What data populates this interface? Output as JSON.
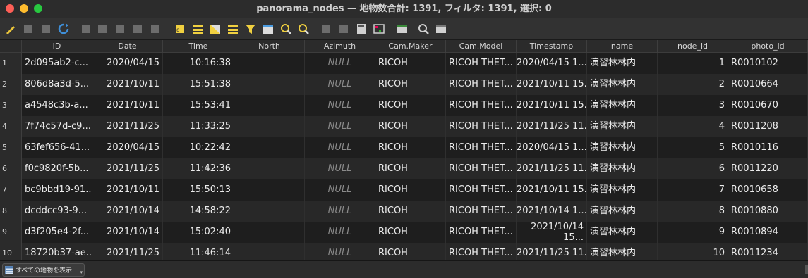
{
  "window": {
    "title": "panorama_nodes — 地物数合計: 1391, フィルタ: 1391, 選択: 0"
  },
  "toolbar": {
    "buttons": [
      {
        "name": "toggle-editing-pencil-icon",
        "color": "#e9c43a"
      },
      {
        "name": "multi-edit-icon",
        "color": "#7a7a7a"
      },
      {
        "name": "save-edits-icon",
        "color": "#7a7a7a"
      },
      {
        "name": "reload-table-icon",
        "color": "#3f8fd8"
      },
      {
        "name": "add-feature-icon",
        "color": "#7a7a7a"
      },
      {
        "name": "delete-feature-icon",
        "color": "#7a7a7a"
      },
      {
        "name": "cut-icon",
        "color": "#7a7a7a"
      },
      {
        "name": "copy-icon",
        "color": "#7a7a7a"
      },
      {
        "name": "paste-icon",
        "color": "#7a7a7a"
      },
      {
        "name": "select-by-expression-icon",
        "color": "#f0d040"
      },
      {
        "name": "select-all-icon",
        "color": "#f0d040"
      },
      {
        "name": "invert-selection-icon",
        "color": "#f0d040"
      },
      {
        "name": "deselect-all-icon",
        "color": "#f0d040"
      },
      {
        "name": "filter-select-icon",
        "color": "#f0d040"
      },
      {
        "name": "move-selection-top-icon",
        "color": "#4a9be0"
      },
      {
        "name": "pan-to-selected-icon",
        "color": "#f0d040"
      },
      {
        "name": "zoom-to-selected-icon",
        "color": "#f0d040"
      },
      {
        "name": "new-field-icon",
        "color": "#7a7a7a"
      },
      {
        "name": "delete-field-icon",
        "color": "#7a7a7a"
      },
      {
        "name": "field-calculator-icon",
        "color": "#d0d0d0"
      },
      {
        "name": "conditional-formatting-icon",
        "color": "#d0d0d0"
      },
      {
        "name": "dock-table-icon",
        "color": "#d0d0d0"
      },
      {
        "name": "actions-icon",
        "color": "#d0d0d0"
      },
      {
        "name": "table-view-icon",
        "color": "#d0d0d0"
      }
    ]
  },
  "table": {
    "columns": [
      "ID",
      "Date",
      "Time",
      "North",
      "Azimuth",
      "Cam.Maker",
      "Cam.Model",
      "Timestamp",
      "name",
      "node_id",
      "photo_id"
    ],
    "null_text": "NULL",
    "rows": [
      {
        "num": "1",
        "id": "2d095ab2-c...",
        "date": "2020/04/15",
        "time": "10:16:38",
        "north": "",
        "azimuth": "NULL",
        "maker": "RICOH",
        "model": "RICOH THET...",
        "timestamp": "2020/04/15 1...",
        "name": "演習林林内",
        "node_id": "1",
        "photo_id": "R0010102"
      },
      {
        "num": "2",
        "id": "806d8a3d-5...",
        "date": "2021/10/11",
        "time": "15:51:38",
        "north": "",
        "azimuth": "NULL",
        "maker": "RICOH",
        "model": "RICOH THET...",
        "timestamp": "2021/10/11 15...",
        "name": "演習林林内",
        "node_id": "2",
        "photo_id": "R0010664"
      },
      {
        "num": "3",
        "id": "a4548c3b-a...",
        "date": "2021/10/11",
        "time": "15:53:41",
        "north": "",
        "azimuth": "NULL",
        "maker": "RICOH",
        "model": "RICOH THET...",
        "timestamp": "2021/10/11 15...",
        "name": "演習林林内",
        "node_id": "3",
        "photo_id": "R0010670"
      },
      {
        "num": "4",
        "id": "7f74c57d-c9...",
        "date": "2021/11/25",
        "time": "11:33:25",
        "north": "",
        "azimuth": "NULL",
        "maker": "RICOH",
        "model": "RICOH THET...",
        "timestamp": "2021/11/25 11...",
        "name": "演習林林内",
        "node_id": "4",
        "photo_id": "R0011208"
      },
      {
        "num": "5",
        "id": "63fef656-41...",
        "date": "2020/04/15",
        "time": "10:22:42",
        "north": "",
        "azimuth": "NULL",
        "maker": "RICOH",
        "model": "RICOH THET...",
        "timestamp": "2020/04/15 1...",
        "name": "演習林林内",
        "node_id": "5",
        "photo_id": "R0010116"
      },
      {
        "num": "6",
        "id": "f0c9820f-5b...",
        "date": "2021/11/25",
        "time": "11:42:36",
        "north": "",
        "azimuth": "NULL",
        "maker": "RICOH",
        "model": "RICOH THET...",
        "timestamp": "2021/11/25 11...",
        "name": "演習林林内",
        "node_id": "6",
        "photo_id": "R0011220"
      },
      {
        "num": "7",
        "id": "bc9bbd19-91...",
        "date": "2021/10/11",
        "time": "15:50:13",
        "north": "",
        "azimuth": "NULL",
        "maker": "RICOH",
        "model": "RICOH THET...",
        "timestamp": "2021/10/11 15...",
        "name": "演習林林内",
        "node_id": "7",
        "photo_id": "R0010658"
      },
      {
        "num": "8",
        "id": "dcddcc93-9...",
        "date": "2021/10/14",
        "time": "14:58:22",
        "north": "",
        "azimuth": "NULL",
        "maker": "RICOH",
        "model": "RICOH THET...",
        "timestamp": "2021/10/14 1...",
        "name": "演習林林内",
        "node_id": "8",
        "photo_id": "R0010880"
      },
      {
        "num": "9",
        "id": "d3f205e4-2f...",
        "date": "2021/10/14",
        "time": "15:02:40",
        "north": "",
        "azimuth": "NULL",
        "maker": "RICOH",
        "model": "RICOH THET...",
        "timestamp": "2021/10/14 15...",
        "name": "演習林林内",
        "node_id": "9",
        "photo_id": "R0010894"
      },
      {
        "num": "10",
        "id": "18720b37-ae...",
        "date": "2021/11/25",
        "time": "11:46:14",
        "north": "",
        "azimuth": "NULL",
        "maker": "RICOH",
        "model": "RICOH THET...",
        "timestamp": "2021/11/25 11...",
        "name": "演習林林内",
        "node_id": "10",
        "photo_id": "R0011234"
      }
    ]
  },
  "status": {
    "show_all_label": "すべての地物を表示"
  }
}
